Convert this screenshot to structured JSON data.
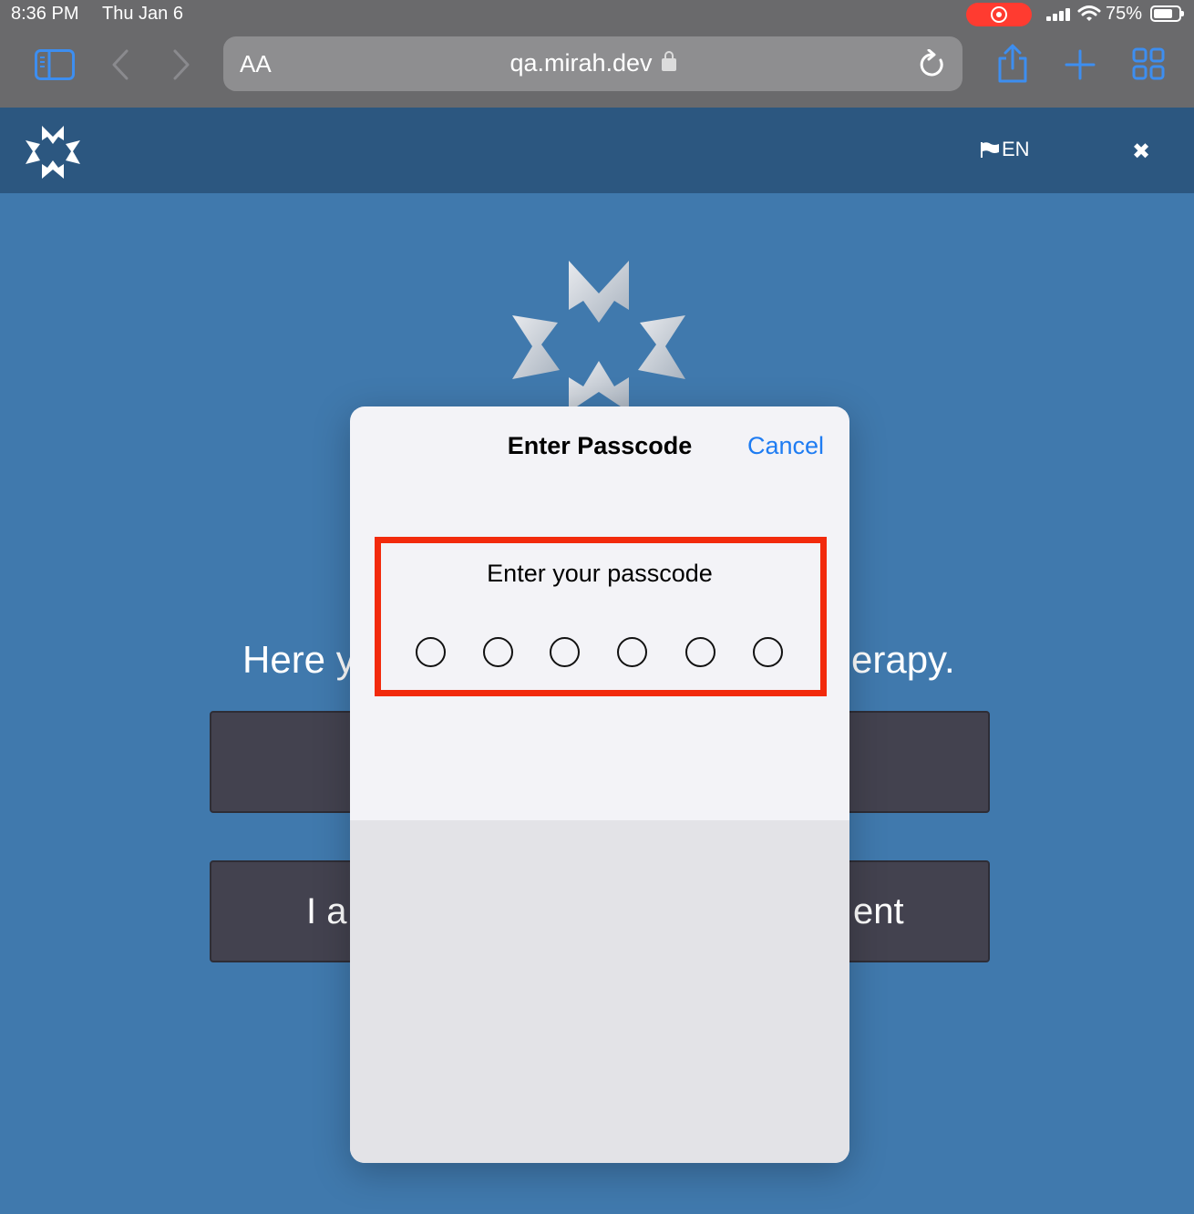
{
  "status_bar": {
    "time": "8:36 PM",
    "date": "Thu Jan 6",
    "battery": "75%",
    "battery_level": 0.75
  },
  "safari": {
    "text_size_label": "AA",
    "url": "qa.mirah.dev"
  },
  "app_header": {
    "language": "EN"
  },
  "background": {
    "hero_left_fragment": "Here y",
    "hero_right_fragment": "erapy.",
    "button2_left_fragment": "I a",
    "button2_right_fragment": "ent"
  },
  "modal": {
    "title": "Enter Passcode",
    "cancel": "Cancel",
    "prompt": "Enter your passcode",
    "digits_total": 6,
    "digits_entered": 0
  },
  "colors": {
    "page_bg": "#4079ad",
    "header_bg": "#2c5780",
    "accent_blue": "#1e7cf2",
    "highlight_red": "#f22a0c",
    "button_bg": "#43424f"
  }
}
